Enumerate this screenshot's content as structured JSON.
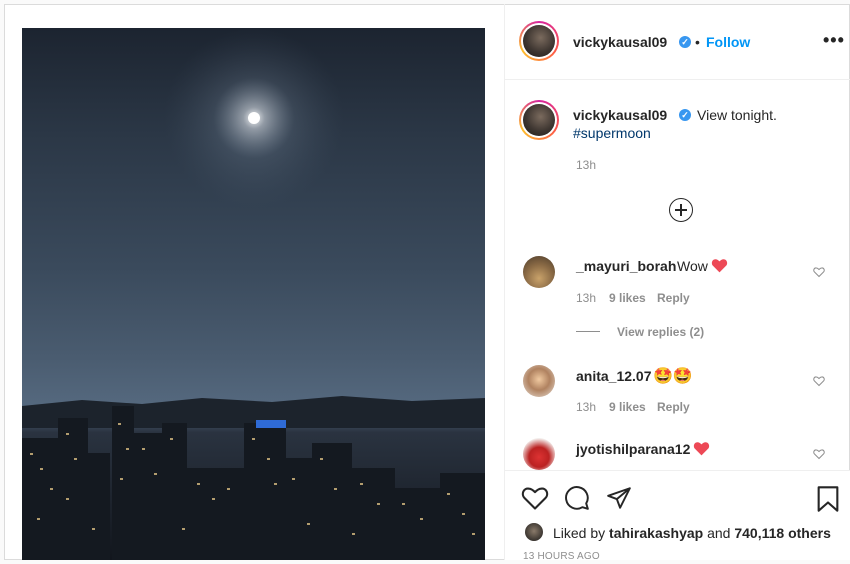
{
  "post": {
    "username": "vickykausal09",
    "follow_label": "Follow",
    "separator": "•",
    "more_label": "•••",
    "caption_text": "View tonight.",
    "hashtag": "#supermoon",
    "caption_time": "13h"
  },
  "comments": [
    {
      "user": "_mayuri_borah",
      "text": "Wow",
      "emoji": "heart",
      "time": "13h",
      "likes": "9 likes",
      "reply": "Reply"
    },
    {
      "user": "anita_12.07",
      "text": "",
      "emoji": "starstruck",
      "time": "13h",
      "likes": "9 likes",
      "reply": "Reply"
    },
    {
      "user": "jyotishilparana12",
      "text": "",
      "emoji": "heart"
    }
  ],
  "view_replies": "View replies (2)",
  "likes_line": {
    "prefix": "Liked by ",
    "user": "tahirakashyap",
    "middle": " and ",
    "count": "740,118 others"
  },
  "timestamp": "13 HOURS AGO",
  "icons": [
    "heart-outline-icon",
    "comment-icon",
    "share-icon",
    "bookmark-icon",
    "verified-icon",
    "add-comment-icon"
  ],
  "colors": {
    "follow": "#0095f6",
    "verified": "#3897f0",
    "hashtag": "#00376b",
    "heart": "#ed4956",
    "muted": "#8e8e8e"
  }
}
